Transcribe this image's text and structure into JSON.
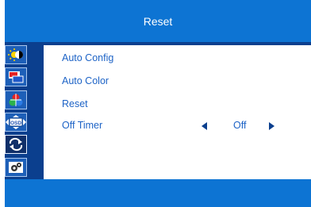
{
  "window": {
    "title": "Reset"
  },
  "sidebar": {
    "tabs": [
      {
        "name": "brightness-contrast",
        "icon": "sun-contrast-icon",
        "selected": false
      },
      {
        "name": "color",
        "icon": "color-blocks-icon",
        "selected": false
      },
      {
        "name": "image",
        "icon": "picture-icon",
        "selected": false
      },
      {
        "name": "osd",
        "icon": "osd-icon",
        "label": "OSD",
        "selected": false
      },
      {
        "name": "reset",
        "icon": "reset-arrows-icon",
        "selected": true
      },
      {
        "name": "misc",
        "icon": "gears-icon",
        "selected": false
      }
    ]
  },
  "menu": {
    "items": [
      {
        "label": "Auto Config"
      },
      {
        "label": "Auto Color"
      },
      {
        "label": "Reset"
      },
      {
        "label": "Off Timer",
        "value": "Off"
      }
    ]
  },
  "colors": {
    "accent": "#0d74d3",
    "sidebar": "#0b3f8e",
    "text": "#1d63c6"
  }
}
